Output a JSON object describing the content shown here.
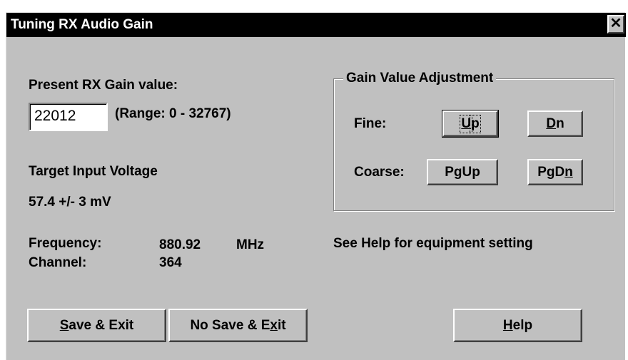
{
  "window": {
    "title": "Tuning RX Audio Gain",
    "close_glyph": "✕"
  },
  "gain": {
    "label": "Present RX Gain value:",
    "value": "22012",
    "range": "(Range: 0 - 32767)"
  },
  "target": {
    "label": "Target Input Voltage",
    "value": "57.4 +/- 3 mV"
  },
  "info": {
    "frequency_label": "Frequency:",
    "frequency_value": "880.92",
    "frequency_unit": "MHz",
    "channel_label": "Channel:",
    "channel_value": "364"
  },
  "adjust": {
    "group_title": "Gain Value Adjustment",
    "fine_label": "Fine:",
    "coarse_label": "Coarse:",
    "up": {
      "mnemonic": "U",
      "rest": "p"
    },
    "dn": {
      "mnemonic": "D",
      "rest": "n"
    },
    "pgup": {
      "pre": "P",
      "mnemonic": "g",
      "post": "Up"
    },
    "pgdn": {
      "pre": "PgD",
      "mnemonic": "n",
      "post": ""
    }
  },
  "help_note": "See Help for equipment setting",
  "buttons": {
    "save_exit": {
      "mnemonic": "S",
      "rest": "ave & Exit"
    },
    "nosave_exit": {
      "pre": "No Save & E",
      "mnemonic": "x",
      "post": "it"
    },
    "help": {
      "mnemonic": "H",
      "rest": "elp"
    }
  }
}
